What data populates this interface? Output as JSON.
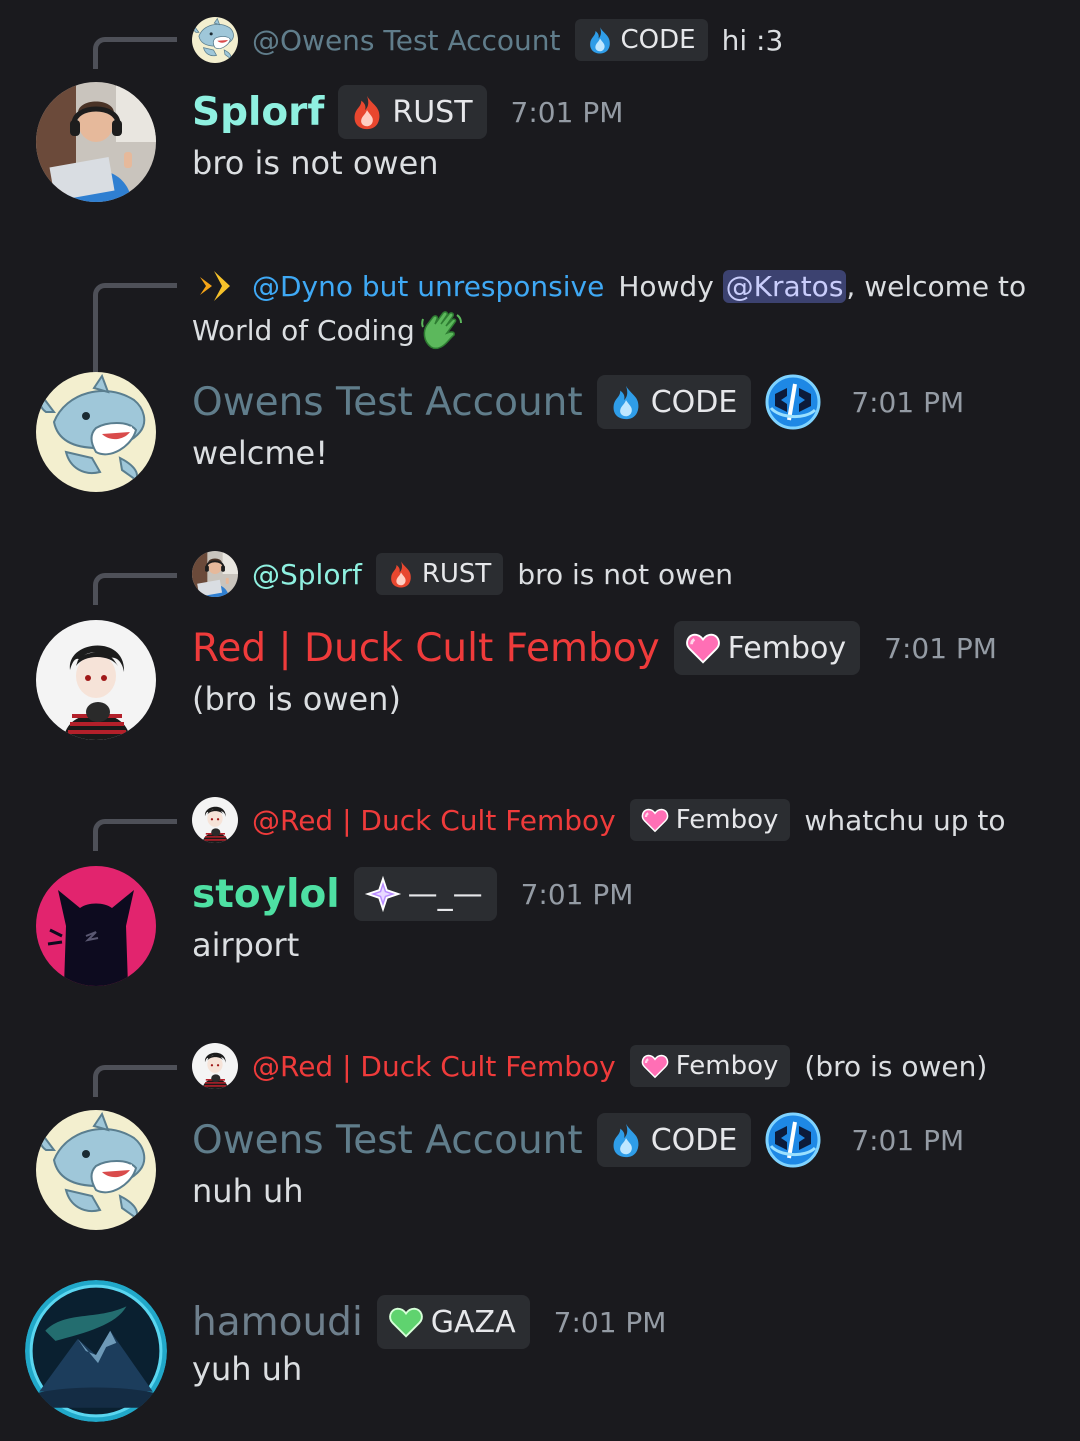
{
  "colors": {
    "background": "#1a1a1e",
    "tag_bg": "#2b2d31",
    "splorf": "#8ff0e0",
    "owens": "#607d8b",
    "red": "#ef3b3b",
    "stoylol": "#4ee0a3",
    "hamoudi": "#6e7f8c",
    "dyno": "#3fa9f5",
    "timestamp": "#949ba4"
  },
  "messages": [
    {
      "reply": {
        "avatar_icon": "shark-mini-avatar",
        "name": "@Owens Test Account",
        "tag_icon": "blue-flame-icon",
        "tag": "CODE",
        "text": "hi :3"
      },
      "username": "Splorf",
      "tag_icon": "red-flame-icon",
      "tag": "RUST",
      "timestamp": "7:01 PM",
      "content": "bro is not owen"
    },
    {
      "reply": {
        "avatar_icon": "dyno-diamond-icon",
        "name": "@Dyno but unresponsive",
        "text_prefix": "Howdy ",
        "mention": "@Kratos",
        "text_suffix": ", welcome to",
        "text_line2": "World of Coding",
        "emoji": "waving-hand-emoji"
      },
      "username": "Owens Test Account",
      "tag_icon": "blue-flame-icon",
      "tag": "CODE",
      "role_icon": "code-brackets-icon",
      "timestamp": "7:01 PM",
      "content": "welcme!"
    },
    {
      "reply": {
        "avatar_icon": "splorf-mini-avatar",
        "name": "@Splorf",
        "tag_icon": "red-flame-icon",
        "tag": "RUST",
        "text": "bro is not owen"
      },
      "username": "Red | Duck Cult Femboy",
      "tag_icon": "pink-heart-icon",
      "tag": "Femboy",
      "timestamp": "7:01 PM",
      "content": "(bro is owen)"
    },
    {
      "reply": {
        "avatar_icon": "red-mini-avatar",
        "name": "@Red | Duck Cult Femboy",
        "tag_icon": "pink-heart-icon",
        "tag": "Femboy",
        "text": "whatchu up to"
      },
      "username": "stoylol",
      "tag_icon": "sparkle-icon",
      "tag": "—_—",
      "timestamp": "7:01 PM",
      "content": "airport"
    },
    {
      "reply": {
        "avatar_icon": "red-mini-avatar",
        "name": "@Red | Duck Cult Femboy",
        "tag_icon": "pink-heart-icon",
        "tag": "Femboy",
        "text": "(bro is owen)"
      },
      "username": "Owens Test Account",
      "tag_icon": "blue-flame-icon",
      "tag": "CODE",
      "role_icon": "code-brackets-icon",
      "timestamp": "7:01 PM",
      "content": "nuh uh"
    },
    {
      "username": "hamoudi",
      "tag_icon": "green-heart-icon",
      "tag": "GAZA",
      "timestamp": "7:01 PM",
      "content": "yuh uh"
    }
  ]
}
